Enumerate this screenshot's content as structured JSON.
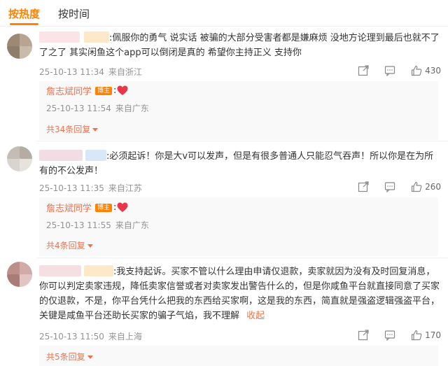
{
  "tabs": [
    {
      "label": "按热度",
      "active": true
    },
    {
      "label": "按时间",
      "active": false
    }
  ],
  "colors": {
    "accent": "#ff8200",
    "link": "#eb7350",
    "meta": "#939393"
  },
  "comments": [
    {
      "text": ":佩服你的勇气 说实话 被骗的大部分受害者都是嫌麻烦 没地方论理到最后也就不了了之了 其实闲鱼这个app可以倒闭是真的 希望你主持正义 支持你",
      "time": "25-10-13 11:34",
      "location": "来自浙江",
      "likes": "430",
      "reply": {
        "name": "詹志斌同学",
        "badge": "博主",
        "colon": ":",
        "emoji": "heart",
        "time": "25-10-13 11:54",
        "location": "来自广东"
      },
      "more": "共34条回复"
    },
    {
      "text": ":必须起诉！你是大v可以发声，但是有很多普通人只能忍气吞声！所以你是在为所有的不公发声！",
      "time": "25-10-13 11:35",
      "location": "来自江苏",
      "likes": "260",
      "reply": {
        "name": "詹志斌同学",
        "badge": "博主",
        "colon": ":",
        "emoji": "heart",
        "time": "25-10-13 11:55",
        "location": "来自广东"
      },
      "more": "共4条回复"
    },
    {
      "text": ":我支持起诉。买家不管以什么理由申请仅退款，卖家就因为没有及时回复消息，你可以判定卖家违规，降低卖家信誉或者对卖家发出警告什么的，但是你咸鱼平台就直接同意了买家的仅退款，不是，你平台凭什么把我的东西给买家啊，这是我的东西，简直就是强盗逻辑强盗平台，关键是咸鱼平台还助长买家的骗子气焰，我不理解",
      "fold": "收起",
      "time": "25-10-13 11:50",
      "location": "来自上海",
      "likes": "170",
      "more": "共5条回复"
    }
  ]
}
